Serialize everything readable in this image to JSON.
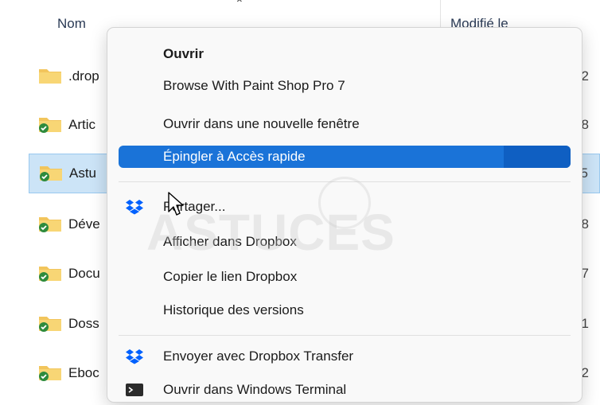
{
  "explorer": {
    "columns": {
      "name": "Nom",
      "modified": "Modifié le"
    },
    "files": [
      {
        "name": ".drop",
        "date": "2",
        "icon": "folder-icon"
      },
      {
        "name": "Artic",
        "date": "8",
        "icon": "synced-folder-icon"
      },
      {
        "name": "Astu",
        "date": "5",
        "icon": "synced-folder-icon",
        "selected": true
      },
      {
        "name": "Déve",
        "date": "8",
        "icon": "synced-folder-icon"
      },
      {
        "name": "Docu",
        "date": "7",
        "icon": "synced-folder-icon"
      },
      {
        "name": "Doss",
        "date": "1",
        "icon": "synced-folder-icon"
      },
      {
        "name": "Eboc",
        "date": "2",
        "icon": "synced-folder-icon"
      }
    ]
  },
  "context_menu": {
    "items": [
      {
        "label": "Ouvrir",
        "bold": true
      },
      {
        "label": "Browse With Paint Shop Pro 7"
      },
      {
        "label": "Ouvrir dans une nouvelle fenêtre"
      },
      {
        "label": "Épingler à Accès rapide",
        "highlighted": true
      },
      {
        "label": "Partager...",
        "icon": "dropbox-icon"
      },
      {
        "label": "Afficher dans Dropbox"
      },
      {
        "label": "Copier le lien Dropbox"
      },
      {
        "label": "Historique des versions"
      },
      {
        "label": "Envoyer avec Dropbox Transfer",
        "icon": "dropbox-icon"
      },
      {
        "label": "Ouvrir dans Windows Terminal",
        "icon": "terminal-icon"
      }
    ]
  },
  "watermark": {
    "text": "ASTUCES"
  },
  "colors": {
    "highlight": "#1a73d8",
    "selection": "#cce4f7",
    "dropbox": "#0061fe",
    "folder": "#f2c55c",
    "sync_badge": "#2e8b3d"
  }
}
